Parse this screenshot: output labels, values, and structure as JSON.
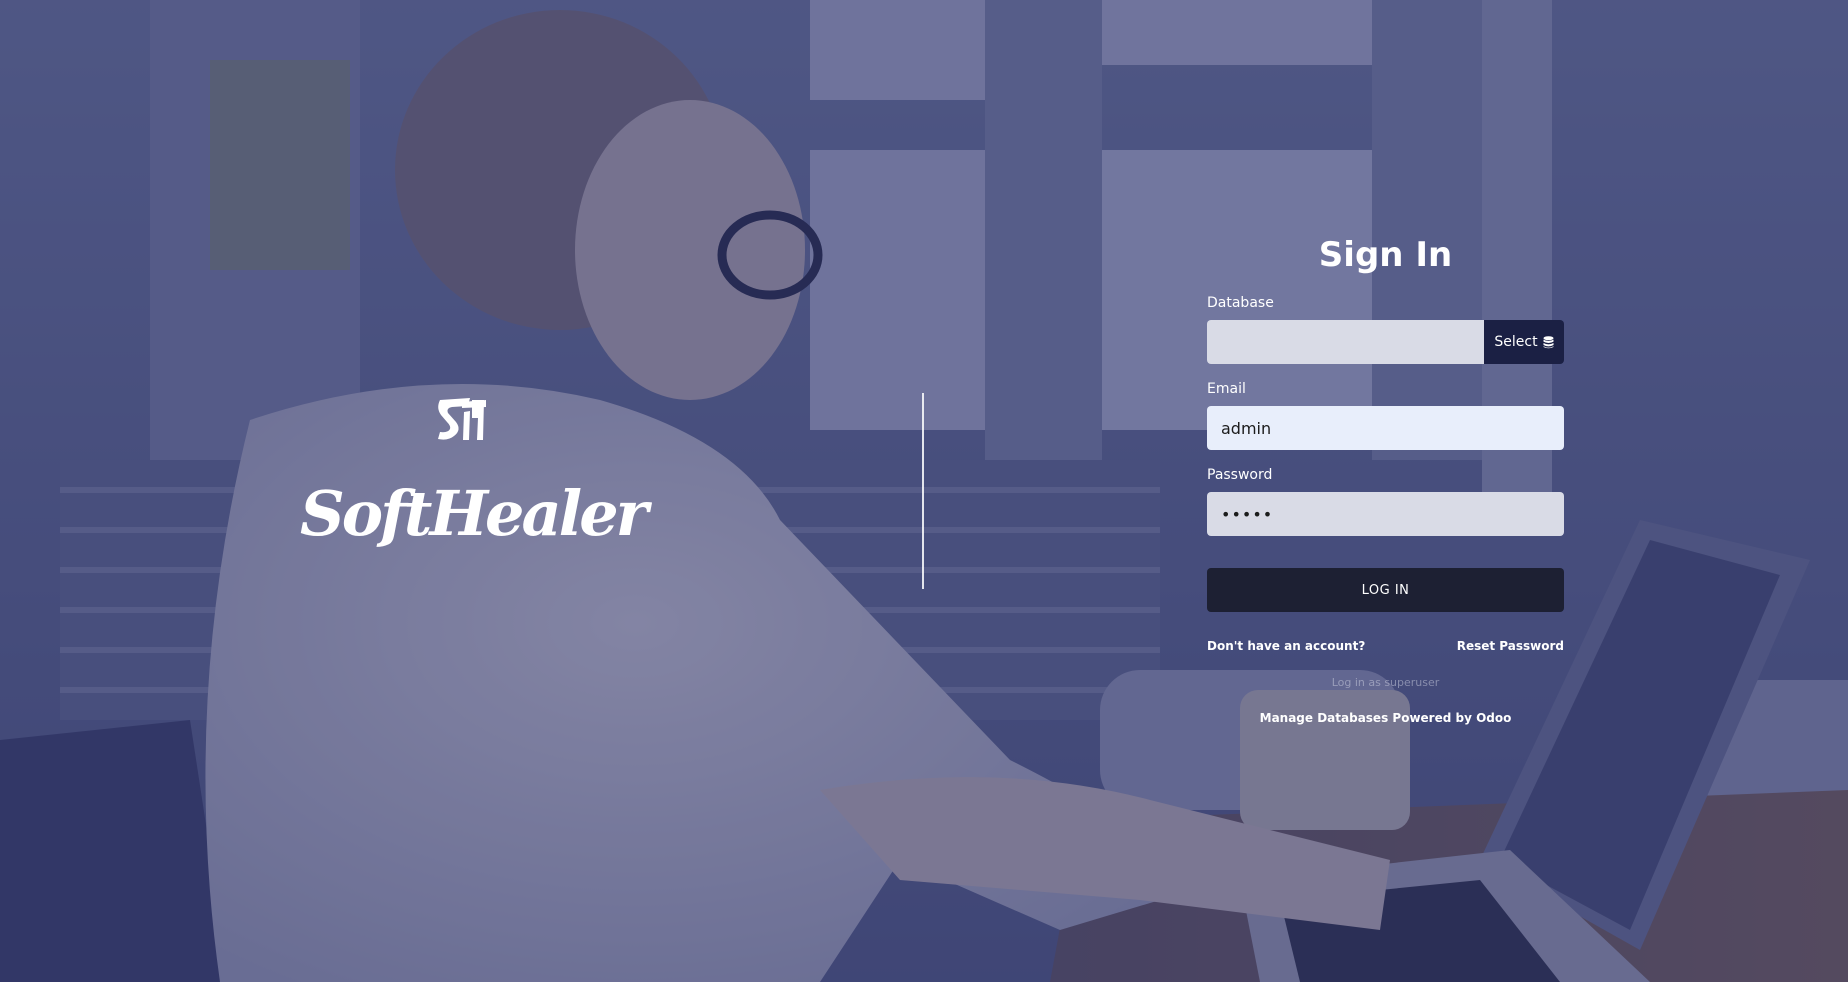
{
  "brand": {
    "name": "SoftHealer",
    "logo_icon": "softhealer-sh-mark-icon"
  },
  "login_form": {
    "title": "Sign In",
    "database": {
      "label": "Database",
      "value": "",
      "select_label": "Select",
      "select_icon": "database-icon"
    },
    "email": {
      "label": "Email",
      "value": "admin"
    },
    "password": {
      "label": "Password",
      "value": "•••••"
    },
    "login_label": "LOG IN",
    "signup_link": "Don't have an account?",
    "reset_link": "Reset Password",
    "superuser_link": "Log in as superuser",
    "manage_databases": "Manage Databases",
    "powered_by_prefix": "Powered by",
    "powered_by_brand": "Odoo"
  },
  "colors": {
    "overlay": "#2c3060",
    "select_button": "#1b2044",
    "login_button": "#1d2033",
    "email_field": "#e8eefb",
    "muted_field": "#d9dbe6"
  }
}
